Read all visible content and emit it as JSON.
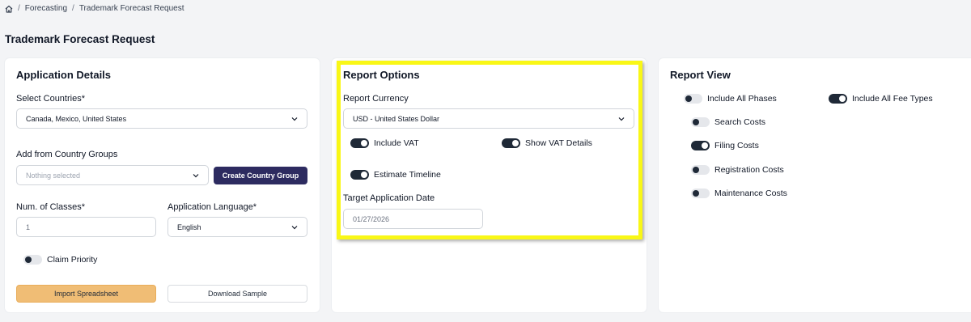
{
  "breadcrumb": {
    "items": [
      "Forecasting",
      "Trademark Forecast Request"
    ],
    "separator": "/"
  },
  "page_title": "Trademark Forecast Request",
  "application_details": {
    "title": "Application Details",
    "countries_label": "Select Countries*",
    "countries_value": "Canada, Mexico, United States",
    "groups_label": "Add from Country Groups",
    "groups_placeholder": "Nothing selected",
    "create_group_label": "Create Country Group",
    "classes_label": "Num. of Classes*",
    "classes_value": "1",
    "language_label": "Application Language*",
    "language_value": "English",
    "claim_priority_label": "Claim Priority",
    "claim_priority_on": false,
    "import_label": "Import Spreadsheet",
    "download_label": "Download Sample"
  },
  "report_options": {
    "title": "Report Options",
    "currency_label": "Report Currency",
    "currency_value": "USD - United States Dollar",
    "include_vat_label": "Include VAT",
    "include_vat_on": true,
    "show_vat_label": "Show VAT Details",
    "show_vat_on": true,
    "estimate_timeline_label": "Estimate Timeline",
    "estimate_timeline_on": true,
    "target_date_label": "Target Application Date",
    "target_date_value": "01/27/2026"
  },
  "report_view": {
    "title": "Report View",
    "include_all_phases_label": "Include All Phases",
    "include_all_phases_on": false,
    "include_all_fee_types_label": "Include All Fee Types",
    "include_all_fee_types_on": true,
    "search_costs_label": "Search Costs",
    "search_costs_on": false,
    "filing_costs_label": "Filing Costs",
    "filing_costs_on": true,
    "registration_costs_label": "Registration Costs",
    "registration_costs_on": false,
    "maintenance_costs_label": "Maintenance Costs",
    "maintenance_costs_on": false
  },
  "colors": {
    "background": "#f3f4f6",
    "primary_button": "#2d2b60",
    "import_button": "#f0bd75",
    "highlight": "#f9f716",
    "toggle_on": "#1f2937"
  }
}
